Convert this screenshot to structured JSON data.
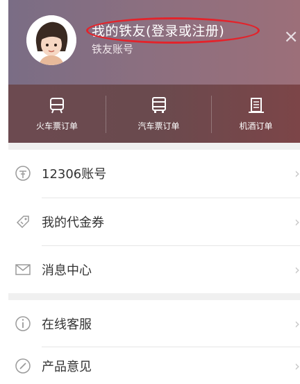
{
  "profile": {
    "username": "我的铁友(登录或注册)",
    "account_label": "铁友账号"
  },
  "orders": [
    {
      "label": "火车票订单",
      "icon": "train-icon"
    },
    {
      "label": "汽车票订单",
      "icon": "bus-icon"
    },
    {
      "label": "机酒订单",
      "icon": "hotel-icon"
    }
  ],
  "menu_section_1": [
    {
      "label": "12306账号",
      "icon": "railway-logo-icon"
    },
    {
      "label": "我的代金券",
      "icon": "voucher-icon"
    },
    {
      "label": "消息中心",
      "icon": "mail-icon"
    }
  ],
  "menu_section_2": [
    {
      "label": "在线客服",
      "icon": "info-icon"
    },
    {
      "label": "产品意见",
      "icon": "feedback-icon"
    }
  ],
  "colors": {
    "highlight": "#e3232b",
    "header": "#8b6f80",
    "order_bar": "#6a4a4e"
  }
}
